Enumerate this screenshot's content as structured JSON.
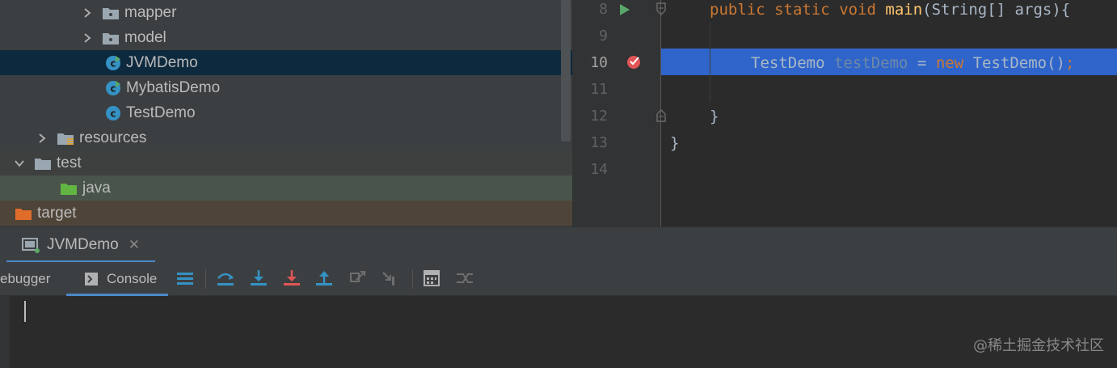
{
  "colors": {
    "tree_bg": "#3c3f41",
    "selection_bg": "#0d293e",
    "editor_bg": "#2b2b2b",
    "line_highlight": "#2f65ca",
    "keyword": "#cc7832",
    "method": "#ffc66d",
    "accent_underline": "#4a88c7",
    "breakpoint": "#e05555",
    "run_arrow": "#59a869"
  },
  "project_tree": {
    "items": [
      {
        "label": "mapper",
        "type": "package",
        "expanded": false
      },
      {
        "label": "model",
        "type": "package",
        "expanded": false
      },
      {
        "label": "JVMDemo",
        "type": "class-runnable",
        "selected": true
      },
      {
        "label": "MybatisDemo",
        "type": "class-runnable"
      },
      {
        "label": "TestDemo",
        "type": "class"
      },
      {
        "label": "resources",
        "type": "resources-folder",
        "expanded": false
      },
      {
        "label": "test",
        "type": "folder",
        "expanded": true
      },
      {
        "label": "java",
        "type": "test-sources-folder"
      },
      {
        "label": "target",
        "type": "excluded-folder"
      }
    ]
  },
  "editor": {
    "line_numbers": [
      "8",
      "9",
      "10",
      "11",
      "12",
      "13",
      "14"
    ],
    "current_line": "10",
    "lines": {
      "l8_kw1": "public",
      "l8_kw2": "static",
      "l8_kw3": "void",
      "l8_fn": "main",
      "l8_rest": "(String[] args){",
      "l10_type": "TestDemo",
      "l10_var": "testDemo",
      "l10_eq": " = ",
      "l10_new": "new",
      "l10_ctor": " TestDemo()",
      "l10_semi": ";",
      "l12_brace": "}",
      "l13_brace": "}"
    }
  },
  "run_window": {
    "tab_label": "JVMDemo",
    "close_icon": "close-icon"
  },
  "debug_toolbar": {
    "debugger_tab": "ebugger",
    "console_tab": "Console",
    "icons": [
      "threads-menu-icon",
      "step-over-icon",
      "step-into-icon",
      "force-step-into-icon",
      "step-out-icon",
      "drop-frame-icon",
      "run-to-cursor-icon",
      "evaluate-expression-icon",
      "trace-stream-icon"
    ]
  },
  "watermark": "@稀土掘金技术社区"
}
